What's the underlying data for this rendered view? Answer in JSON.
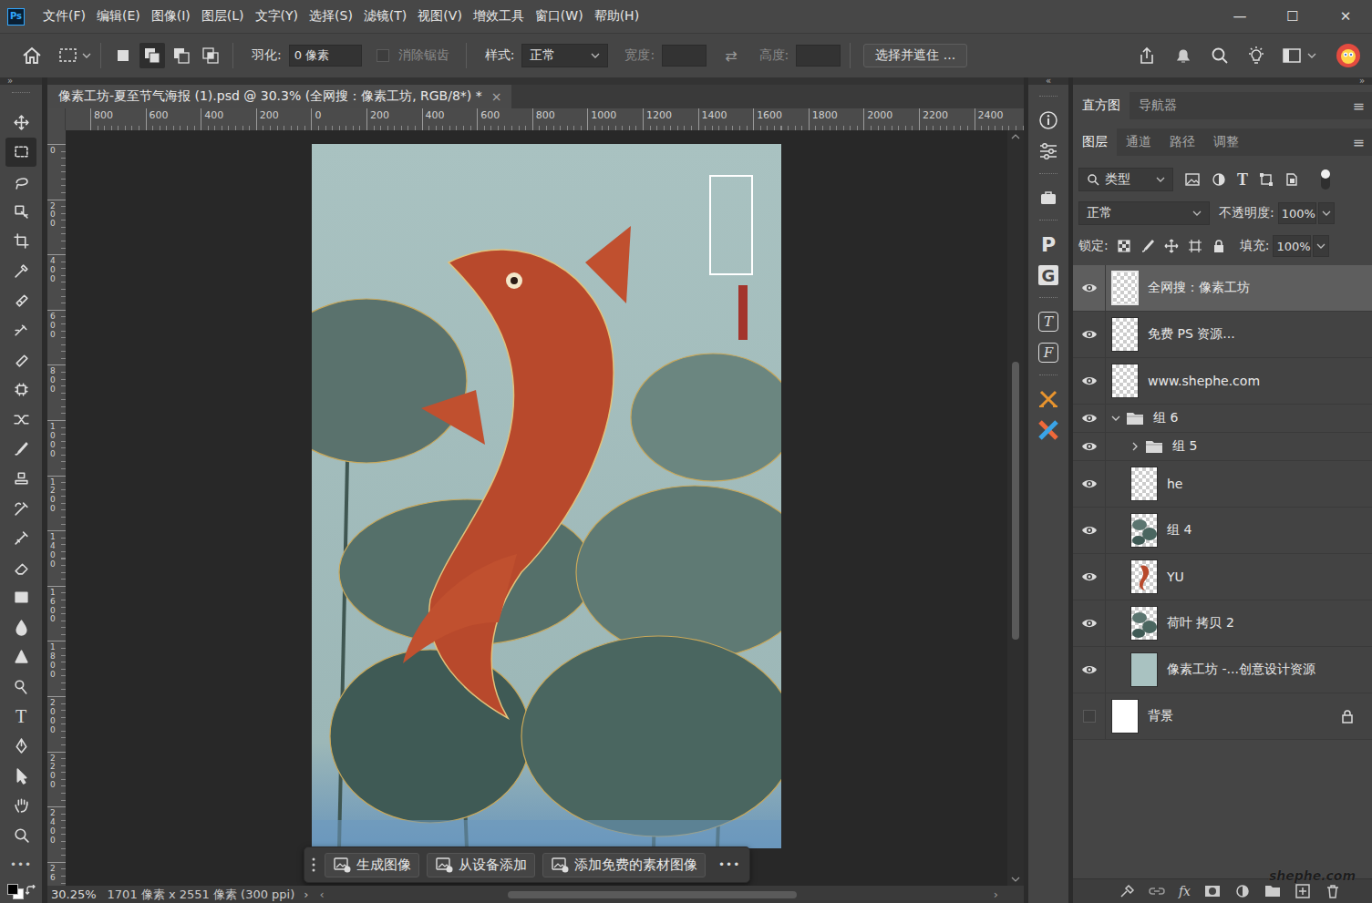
{
  "app_logo": "Ps",
  "menu": [
    "文件(F)",
    "编辑(E)",
    "图像(I)",
    "图层(L)",
    "文字(Y)",
    "选择(S)",
    "滤镜(T)",
    "视图(V)",
    "增效工具",
    "窗口(W)",
    "帮助(H)"
  ],
  "window_controls": [
    "—",
    "☐",
    "✕"
  ],
  "options_bar": {
    "selection_modes": [
      {
        "selected": false
      },
      {
        "selected": true
      },
      {
        "selected": false
      },
      {
        "selected": false
      }
    ],
    "feather_label": "羽化:",
    "feather_value": "0 像素",
    "antialias": {
      "label": "消除锯齿",
      "checked": false,
      "disabled": true
    },
    "style_label": "样式:",
    "style_value": "正常",
    "width_label": "宽度:",
    "width_value": "",
    "swap": "⇄",
    "height_label": "高度:",
    "height_value": "",
    "select_mask_button": "选择并遮住 ..."
  },
  "collapse_marks": {
    "toolbar": "»",
    "strip": "«",
    "panels": "»"
  },
  "tools": [
    {
      "selected": false
    },
    {
      "selected": true
    },
    {
      "selected": false
    },
    {
      "selected": false
    },
    {
      "selected": false
    },
    {
      "selected": false
    },
    {
      "selected": false
    },
    {
      "selected": false
    },
    {
      "selected": false
    },
    {
      "selected": false
    },
    {
      "selected": false
    },
    {
      "selected": false
    },
    {
      "selected": false
    },
    {
      "selected": false
    },
    {
      "selected": false
    },
    {
      "selected": false
    },
    {
      "selected": false
    },
    {
      "selected": false
    },
    {
      "selected": false
    },
    {
      "selected": false
    },
    {
      "selected": false,
      "glyph": "T"
    },
    {
      "selected": false
    },
    {
      "selected": false
    },
    {
      "selected": false
    },
    {
      "selected": false
    }
  ],
  "more_tools": "•••",
  "document": {
    "tab_title": "像素工坊-夏至节气海报 (1).psd @ 30.3% (全网搜：像素工坊, RGB/8*) *",
    "close": "×"
  },
  "rulers": {
    "horizontal": [
      "800",
      "600",
      "400",
      "200",
      "0",
      "200",
      "400",
      "600",
      "800",
      "1000",
      "1200",
      "1400",
      "1600",
      "1800",
      "2000",
      "2200",
      "2400"
    ],
    "vertical": [
      "0",
      "200",
      "400",
      "600",
      "800",
      "1000",
      "1200",
      "1400",
      "1600",
      "1800",
      "2000",
      "2200",
      "2400",
      "26"
    ]
  },
  "scroll": {
    "horizontal": {
      "start": 0.27,
      "size": 0.44
    },
    "vertical": {
      "start": 0.3,
      "size": 0.38
    }
  },
  "contextual_bar": {
    "buttons": [
      "生成图像",
      "从设备添加",
      "添加免费的素材图像"
    ],
    "more": "•••"
  },
  "status_bar": {
    "zoom": "30.25%",
    "info": "1701 像素 x 2551 像素 (300 ppi)",
    "arrow": "›",
    "scroll_left": "‹",
    "scroll_right": "›"
  },
  "side_strip": {
    "letters": [
      "P",
      "G",
      "T",
      "F"
    ]
  },
  "panels": {
    "top_tabs": [
      {
        "label": "直方图",
        "selected": true
      },
      {
        "label": "导航器",
        "selected": false
      }
    ],
    "layer_tabs": [
      {
        "label": "图层",
        "selected": true
      },
      {
        "label": "通道",
        "selected": false
      },
      {
        "label": "路径",
        "selected": false
      },
      {
        "label": "调整",
        "selected": false
      }
    ],
    "menu_glyph": "≡"
  },
  "layers_panel": {
    "filter_label": "类型",
    "filter_type_glyph": "T",
    "filter_on": true,
    "blend_mode": "正常",
    "opacity_label": "不透明度:",
    "opacity": "100%",
    "lock_label": "锁定:",
    "fill_label": "填充:",
    "fill": "100%",
    "footer_fx": "fx"
  },
  "layers": [
    {
      "name": "全网搜：像素工坊",
      "kind": "layer",
      "thumbnail": "transparent",
      "visible": true,
      "selected": true,
      "locked": false,
      "depth": 0
    },
    {
      "name": "免费 PS 资源...",
      "kind": "layer",
      "thumbnail": "transparent",
      "visible": true,
      "selected": false,
      "locked": false,
      "depth": 0
    },
    {
      "name": "www.shephe.com",
      "kind": "layer",
      "thumbnail": "transparent",
      "visible": true,
      "selected": false,
      "locked": false,
      "depth": 0
    },
    {
      "name": "组 6",
      "kind": "group",
      "expanded": true,
      "visible": true,
      "selected": false,
      "locked": false,
      "depth": 0
    },
    {
      "name": "组 5",
      "kind": "group",
      "expanded": false,
      "visible": true,
      "selected": false,
      "locked": false,
      "depth": 1
    },
    {
      "name": "he",
      "kind": "layer",
      "thumbnail": "transparent",
      "visible": true,
      "selected": false,
      "locked": false,
      "depth": 1
    },
    {
      "name": "组 4",
      "kind": "layer",
      "thumbnail": "leaves",
      "visible": true,
      "selected": false,
      "locked": false,
      "depth": 1
    },
    {
      "name": "YU",
      "kind": "layer",
      "thumbnail": "fish",
      "visible": true,
      "selected": false,
      "locked": false,
      "depth": 1
    },
    {
      "name": "荷叶 拷贝 2",
      "kind": "layer",
      "thumbnail": "leaves",
      "visible": true,
      "selected": false,
      "locked": false,
      "depth": 1
    },
    {
      "name": "像素工坊 -...创意设计资源",
      "kind": "layer",
      "thumbnail": "solid",
      "visible": true,
      "selected": false,
      "locked": false,
      "depth": 1
    },
    {
      "name": "背景",
      "kind": "layer",
      "thumbnail": "white",
      "visible": false,
      "selected": false,
      "locked": true,
      "depth": 0
    }
  ],
  "watermark": "shephe.com"
}
